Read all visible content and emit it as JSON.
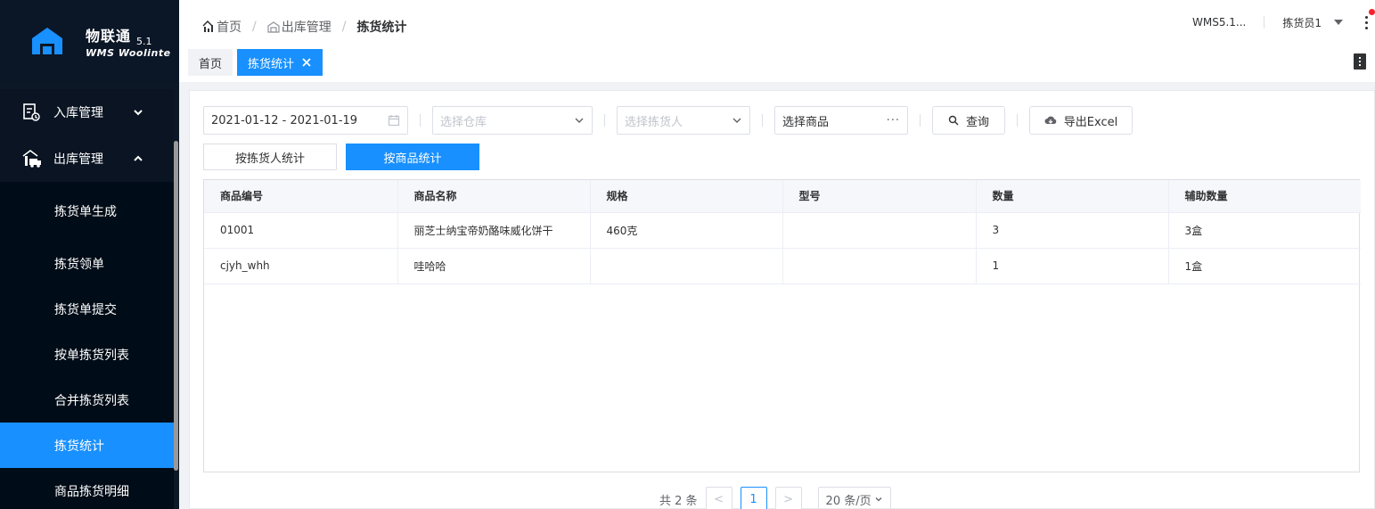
{
  "brand": {
    "name": "物联通",
    "version": "5.1",
    "subtitle": "WMS Woolinte",
    "color": "#1890ff"
  },
  "sidebar": {
    "groups": [
      {
        "label": "入库管理",
        "icon": "inbound-icon",
        "expanded": false
      },
      {
        "label": "出库管理",
        "icon": "outbound-truck-icon",
        "expanded": true
      }
    ],
    "items": [
      {
        "label": "拣货单生成"
      },
      {
        "label": "拣货领单"
      },
      {
        "label": "拣货单提交"
      },
      {
        "label": "按单拣货列表"
      },
      {
        "label": "合并拣货列表"
      },
      {
        "label": "拣货统计",
        "active": true
      },
      {
        "label": "商品拣货明细"
      }
    ]
  },
  "header": {
    "breadcrumb": [
      "首页",
      "出库管理",
      "拣货统计"
    ],
    "system": "WMS5.1...",
    "user": "拣货员1",
    "tabs": [
      {
        "label": "首页",
        "active": false
      },
      {
        "label": "拣货统计",
        "active": true
      }
    ]
  },
  "filters": {
    "date_range": "2021-01-12 - 2021-01-19",
    "warehouse_placeholder": "选择仓库",
    "picker_placeholder": "选择拣货人",
    "product_value": "选择商品",
    "query_label": "查询",
    "export_label": "导出Excel"
  },
  "modes": {
    "by_picker": "按拣货人统计",
    "by_product": "按商品统计",
    "active": "by_product"
  },
  "table": {
    "columns": [
      "商品编号",
      "商品名称",
      "规格",
      "型号",
      "数量",
      "辅助数量"
    ],
    "rows": [
      [
        "01001",
        "丽芝士纳宝帝奶酪味威化饼干",
        "460克",
        "",
        "3",
        "3盒"
      ],
      [
        "cjyh_whh",
        "哇哈哈",
        "",
        "",
        "1",
        "1盒"
      ]
    ]
  },
  "pagination": {
    "total": "共 2 条",
    "current_page": "1",
    "page_size": "20 条/页"
  }
}
